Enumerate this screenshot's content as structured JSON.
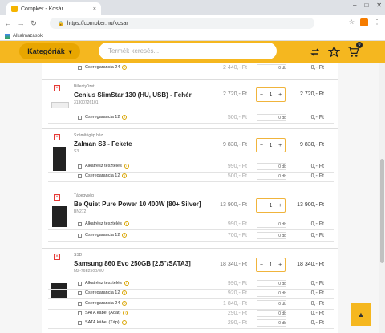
{
  "browser": {
    "tab_title": "Compker - Kosár",
    "tab_close": "×",
    "url": "https://compker.hu/kosar",
    "bookmarks_label": "Alkalmazások",
    "win_min": "–",
    "win_max": "□",
    "win_close": "✕"
  },
  "header": {
    "categories_label": "Kategóriák",
    "categories_icon": "▾",
    "search_placeholder": "Termék keresés...",
    "cart_count": "0"
  },
  "top_row": {
    "service": "Cseregarancia 24",
    "price": "2 440,- Ft",
    "qty": "0 db",
    "total": "0,- Ft"
  },
  "products": [
    {
      "category": "Billentyűzet",
      "name": "Genius SlimStar 130 (HU, USB) - Fehér",
      "code": "31300726101",
      "price": "2 720,- Ft",
      "qty": "1",
      "total": "2 720,- Ft",
      "services": [
        {
          "label": "Cseregarancia 12",
          "price": "500,- Ft",
          "qty": "0 db",
          "total": "0,- Ft"
        }
      ]
    },
    {
      "category": "Számítógép ház",
      "name": "Zalman S3 - Fekete",
      "code": "S3",
      "price": "9 830,- Ft",
      "qty": "1",
      "total": "9 830,- Ft",
      "services": [
        {
          "label": "Alkatrész tesztelés",
          "price": "990,- Ft",
          "qty": "0 db",
          "total": "0,- Ft"
        },
        {
          "label": "Cseregarancia 12",
          "price": "500,- Ft",
          "qty": "0 db",
          "total": "0,- Ft"
        }
      ]
    },
    {
      "category": "Tápegység",
      "name": "Be Quiet Pure Power 10 400W [80+ Silver]",
      "code": "BN272",
      "price": "13 900,- Ft",
      "qty": "1",
      "total": "13 900,- Ft",
      "services": [
        {
          "label": "Alkatrész tesztelés",
          "price": "990,- Ft",
          "qty": "0 db",
          "total": "0,- Ft"
        },
        {
          "label": "Cseregarancia 12",
          "price": "700,- Ft",
          "qty": "0 db",
          "total": "0,- Ft"
        }
      ]
    },
    {
      "category": "SSD",
      "name": "Samsung 860 Evo 250GB [2.5\"/SATA3]",
      "code": "MZ-76E250B/EU",
      "price": "18 340,- Ft",
      "qty": "1",
      "total": "18 340,- Ft",
      "services": [
        {
          "label": "Alkatrész tesztelés",
          "price": "990,- Ft",
          "qty": "0 db",
          "total": "0,- Ft"
        },
        {
          "label": "Cseregarancia 12",
          "price": "920,- Ft",
          "qty": "0 db",
          "total": "0,- Ft"
        },
        {
          "label": "Cseregarancia 24",
          "price": "1 840,- Ft",
          "qty": "0 db",
          "total": "0,- Ft"
        },
        {
          "label": "SATA kábel (Adat)",
          "price": "290,- Ft",
          "qty": "0 db",
          "total": "0,- Ft"
        },
        {
          "label": "SATA kábel (Táp)",
          "price": "290,- Ft",
          "qty": "0 db",
          "total": "0,- Ft"
        }
      ]
    }
  ],
  "glyphs": {
    "minus": "−",
    "plus": "+",
    "remove": "×",
    "info": "i",
    "back": "←",
    "forward": "→",
    "reload": "↻",
    "lock": "🔒",
    "star": "☆",
    "menu": "⋮",
    "up": "▲"
  },
  "colors": {
    "brand": "#f5b71f",
    "remove": "#e53935"
  }
}
